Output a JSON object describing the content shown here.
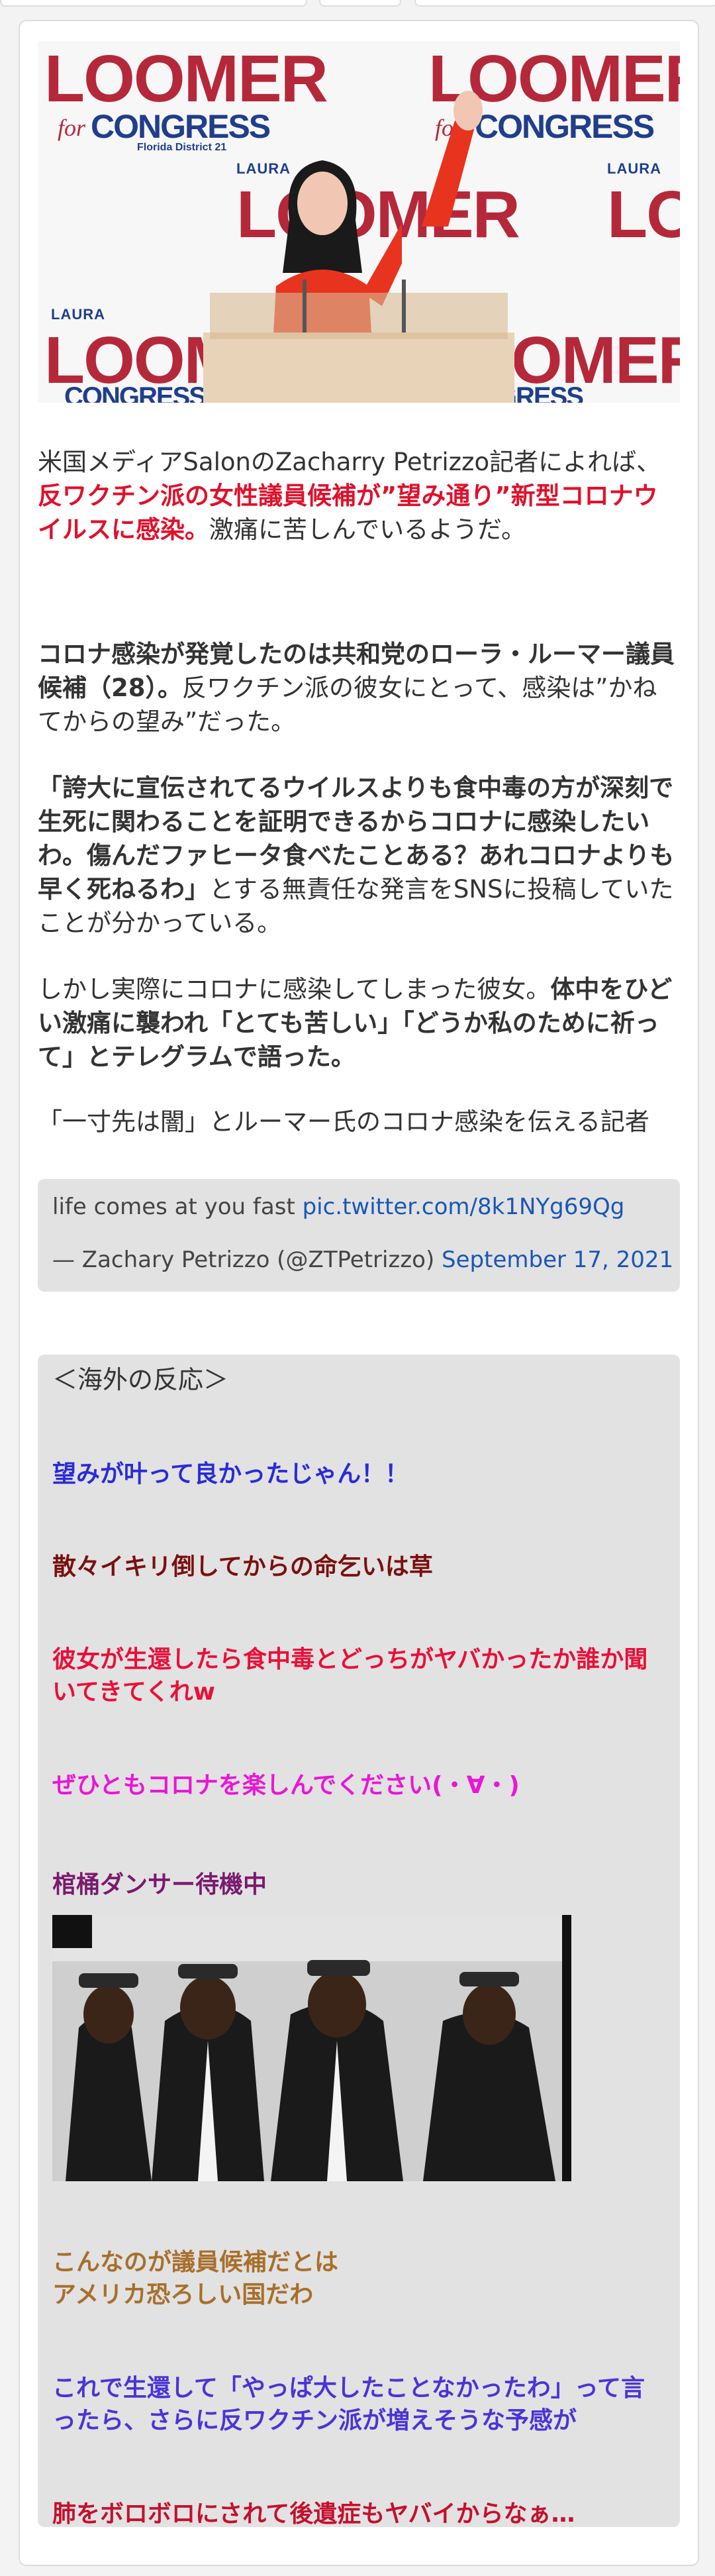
{
  "hero": {
    "sign_loomer": "LOOMER",
    "sign_congress": "CONGRESS",
    "sign_district": "Florida District 21",
    "sign_laura": "LAURA",
    "sign_for": "for"
  },
  "p1": {
    "lead": "米国メディアSalonのZacharry Petrizzo記者によれば、",
    "highlight": "反ワクチン派の女性議員候補が”望み通り”新型コロナウイルスに感染。",
    "tail": "激痛に苦しんでいるようだ。"
  },
  "p2": {
    "bold": "コロナ感染が発覚したのは共和党のローラ・ルーマー議員候補（28）。",
    "rest": "反ワクチン派の彼女にとって、感染は”かねてからの望み”だった。"
  },
  "p3": {
    "bold": "「誇大に宣伝されてるウイルスよりも食中毒の方が深刻で生死に関わることを証明できるからコロナに感染したいわ。傷んだファヒータ食べたことある？あれコロナよりも早く死ねるわ」",
    "rest": "とする無責任な発言をSNSに投稿していたことが分かっている。"
  },
  "p4": {
    "lead": "しかし実際にコロナに感染してしまった彼女。",
    "bold": "体中をひどい激痛に襲われ「とても苦しい」「どうか私のために祈って」とテレグラムで語った。"
  },
  "p5": {
    "text": "「一寸先は闇」とルーマー氏のコロナ感染を伝える記者"
  },
  "tweet": {
    "text": "life comes at you fast ",
    "link": "pic.twitter.com/8k1NYg69Qg",
    "author": "— Zachary Petrizzo (@ZTPetrizzo) ",
    "date": "September 17, 2021"
  },
  "reactions": {
    "title": "＜海外の反応＞",
    "items": [
      {
        "text": "望みが叶って良かったじゃん！！",
        "color": "#2b2bd8"
      },
      {
        "text": "散々イキリ倒してからの命乞いは草",
        "color": "#7a1010"
      },
      {
        "text": "彼女が生還したら食中毒とどっちがヤバかったか誰か聞いてきてくれw",
        "color": "#e8103a"
      },
      {
        "text": "ぜひともコロナを楽しんでください(・∀・)",
        "color": "#ea16d6"
      },
      {
        "text": "棺桶ダンサー待機中",
        "color": "#7a1a6e"
      },
      {
        "text": "こんなのが議員候補だとは\nアメリカ恐ろしい国だわ",
        "color": "#a86f2b"
      },
      {
        "text": "これで生還して「やっぱ大したことなかったわ」って言ったら、さらに反ワクチン派が増えそうな予感が",
        "color": "#4a34d6"
      },
      {
        "text": "肺をボロボロにされて後遺症もヤバイからなぁ…",
        "color": "#c4102e"
      }
    ]
  }
}
